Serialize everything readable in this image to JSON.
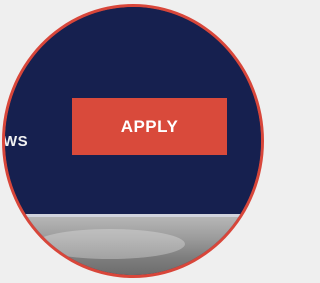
{
  "nav": {
    "partial_item_label": "WS",
    "apply_label": "APPLY"
  },
  "colors": {
    "header_bg": "#16204f",
    "apply_bg": "#d94a3b",
    "lens_border": "#d8463a",
    "page_bg": "#efefef"
  }
}
